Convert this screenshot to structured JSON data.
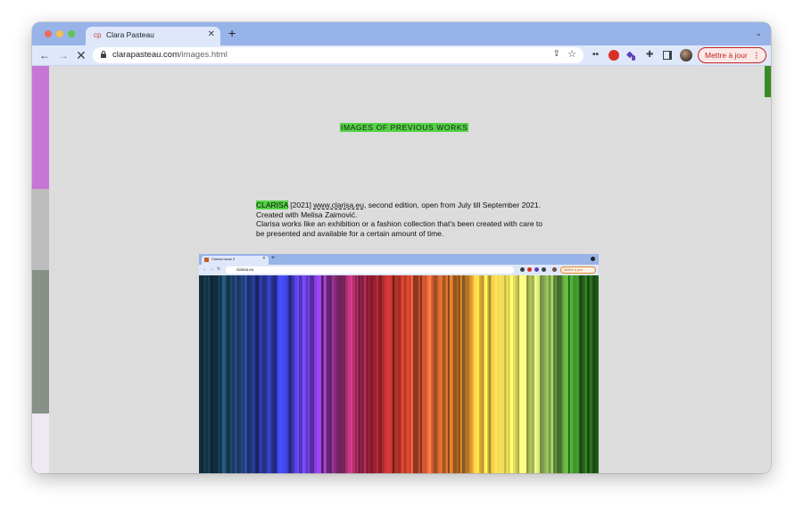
{
  "browser": {
    "tab_title": "Clara Pasteau",
    "tab_favicon": "cp",
    "url_host": "clarapasteau.com",
    "url_path": "/images.html",
    "update_button": "Mettre à jour"
  },
  "page": {
    "heading": "IMAGES OF PREVIOUS WORKS",
    "entry": {
      "tag": "CLARISA",
      "year": "[2021]",
      "link": "www.clarisa.eu",
      "info": ", second edition, open from July till September 2021.",
      "credit": "Created with Melisa Zaimović.",
      "body": "Clarisa works like an exhibition or a fashion collection that's been created with care to be presented and available for a certain amount of time."
    },
    "screenshot": {
      "tab_title": "Clarisa issue 2",
      "url": "clarisa.eu",
      "update_button": "Mettre à jour"
    }
  },
  "colors": {
    "highlight": "#52d244",
    "sidebar": [
      "#c776d6",
      "#bdbdbd",
      "#879188",
      "#efe9f3"
    ],
    "spectrum": [
      "#143240",
      "#1f4f72",
      "#2a3a9a",
      "#3a3fd2",
      "#7a3ad8",
      "#c23a8e",
      "#8a1b2e",
      "#c13a2a",
      "#e8663a",
      "#f08a2e",
      "#f5c542",
      "#f0ec62",
      "#c8ef7a",
      "#3c8a2a",
      "#1f5a16"
    ]
  },
  "icons": {
    "back": "arrow-left-icon",
    "forward": "arrow-right-icon",
    "stop": "close-icon",
    "lock": "lock-icon",
    "share": "share-icon",
    "bookmark": "star-icon",
    "extensions": "puzzle-icon",
    "sidepanel": "side-panel-icon"
  }
}
